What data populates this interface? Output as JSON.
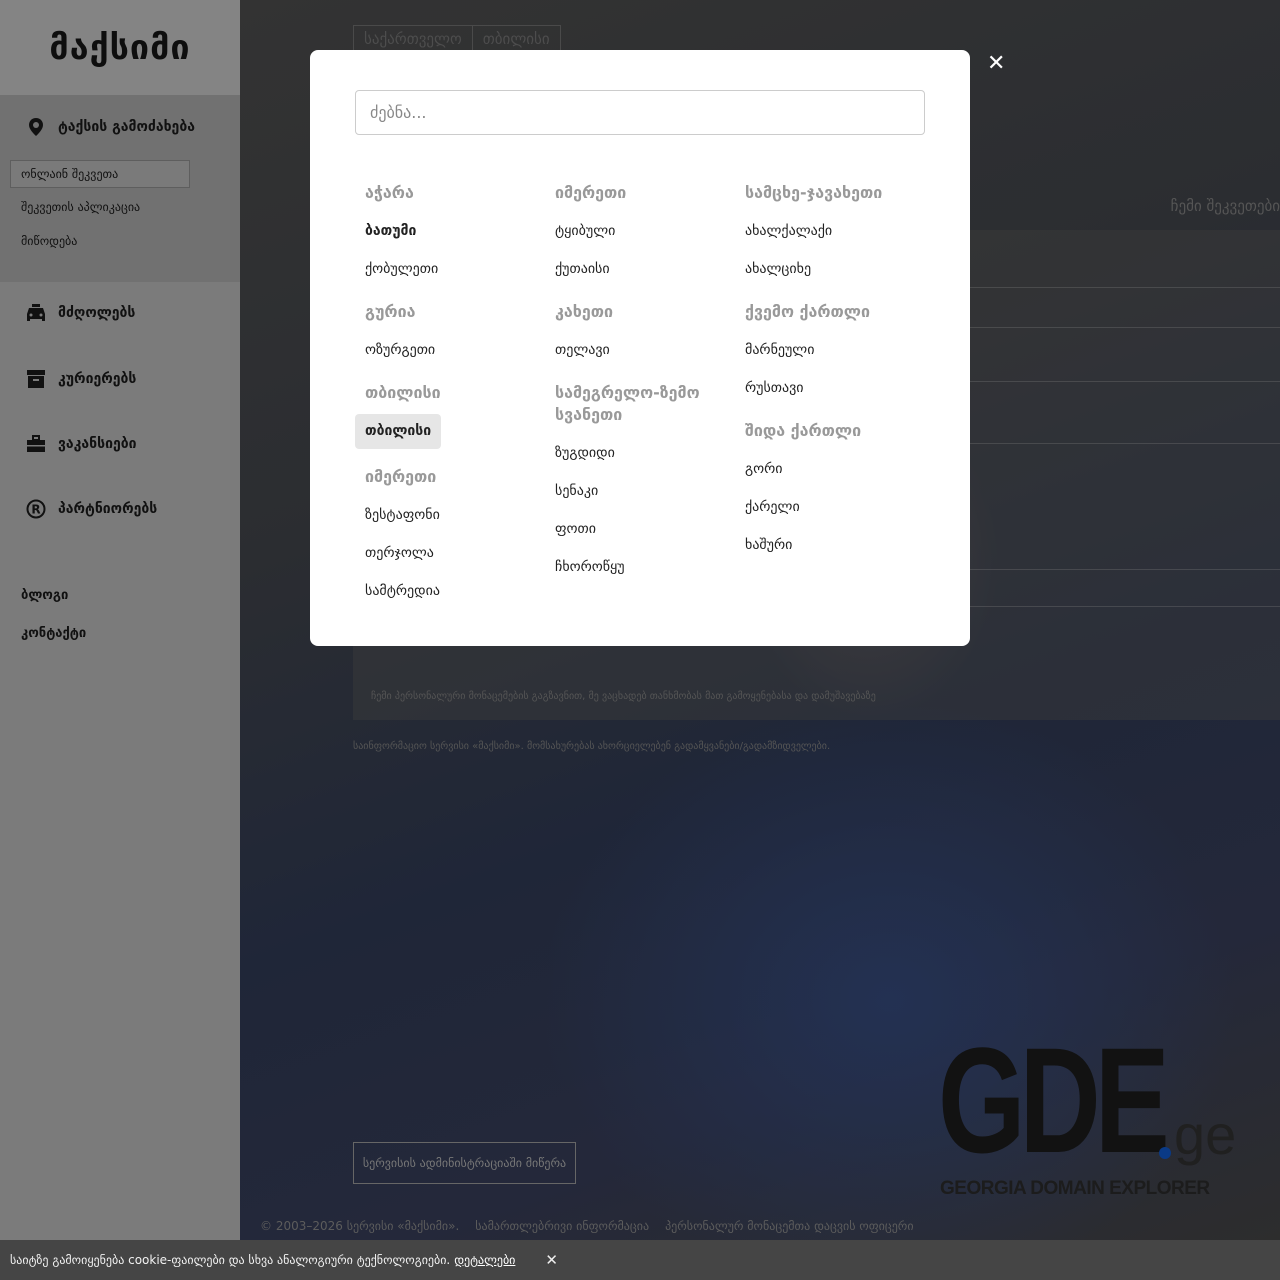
{
  "sidebar": {
    "logo": "მაქსიმი",
    "order_heading": "ტაქსის გამოძახება",
    "order_online": "ონლაინ შეკვეთა",
    "order_app": "შეკვეთის აპლიკაცია",
    "order_delivery": "მიწოდება",
    "nav": [
      {
        "label": "მძღოლებს",
        "icon": "car-icon"
      },
      {
        "label": "კურიერებს",
        "icon": "box-icon"
      },
      {
        "label": "ვაკანსიები",
        "icon": "briefcase-icon"
      },
      {
        "label": "პარტნიორებს",
        "icon": "registered-icon"
      }
    ],
    "blog": "ბლოგი",
    "contacts": "კონტაქტი"
  },
  "main": {
    "breadcrumb": [
      "საქართველო",
      "თბილისი"
    ],
    "my_orders": "ჩემი შეკვეთები",
    "consent": "ჩემი პერსონალური მონაცემების გაგზავნით, მე ვაცხადებ თანხმობას მათ გამოყენებასა და დამუშავებაზე",
    "info": "საინფორმაციო სერვისი «მაქსიმი». მომსახურებას ახორციელებენ გადამყვანები/გადამზიდველები.",
    "admin_button": "სერვისის ადმინისტრაციაში მიწერა",
    "banner": {
      "main": "GDE",
      "tld": "ge",
      "subtitle": "GEORGIA DOMAIN EXPLORER",
      "dot_color": "#0a3a86"
    },
    "footer": [
      "© 2003–2026 სერვისი «მაქსიმი».",
      "სამართლებრივი ინფორმაცია",
      "პერსონალურ მონაცემთა დაცვის ოფიცერი"
    ]
  },
  "modal": {
    "close_icon": "close-icon",
    "search_placeholder": "ძებნა...",
    "columns": [
      [
        {
          "region": "აჭარა",
          "cities": [
            "ბათუმი",
            "ქობულეთი"
          ]
        },
        {
          "region": "გურია",
          "cities": [
            "ოზურგეთი"
          ]
        },
        {
          "region": "თბილისი",
          "cities": [
            "თბილისი"
          ]
        },
        {
          "region": "იმერეთი",
          "cities": [
            "ზესტაფონი",
            "თერჯოლა",
            "სამტრედია"
          ]
        }
      ],
      [
        {
          "region": "იმერეთი",
          "cities": [
            "ტყიბული",
            "ქუთაისი"
          ]
        },
        {
          "region": "კახეთი",
          "cities": [
            "თელავი"
          ]
        },
        {
          "region": "სამეგრელო-ზემო სვანეთი",
          "cities": [
            "ზუგდიდი",
            "სენაკი",
            "ფოთი",
            "ჩხოროწყუ"
          ]
        }
      ],
      [
        {
          "region": "სამცხე-ჯავახეთი",
          "cities": [
            "ახალქალაქი",
            "ახალციხე"
          ]
        },
        {
          "region": "ქვემო ქართლი",
          "cities": [
            "მარნეული",
            "რუსთავი"
          ]
        },
        {
          "region": "შიდა ქართლი",
          "cities": [
            "გორი",
            "ქარელი",
            "ხაშური"
          ]
        }
      ]
    ],
    "bold_city": "ბათუმი",
    "selected_city": "თბილისი"
  },
  "cookie": {
    "text": "საიტზე გამოიყენება cookie-ფაილები და სხვა ანალოგიური ტექნოლოგიები.",
    "link": "დეტალები",
    "close_icon": "close-icon"
  }
}
